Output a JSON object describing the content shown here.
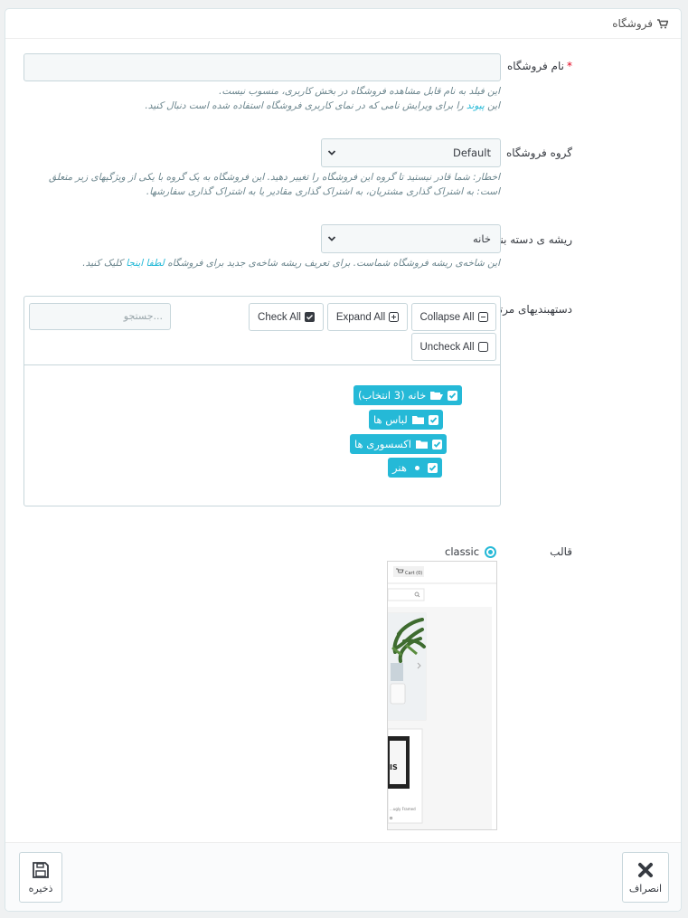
{
  "panel": {
    "title": "فروشگاه",
    "icon": "shopping-cart-icon"
  },
  "shop_name": {
    "label": "نام فروشگاه",
    "required_mark": "*",
    "value": "",
    "help_line1": "این فیلد به نام قابل مشاهده فروشگاه در بخش کاربری، منسوب نیست.",
    "help_line2_prefix": "این",
    "help_line2_link": "پیوند",
    "help_line2_suffix": "را برای ویرایش نامی که در نمای کاربری فروشگاه استفاده شده است دنبال کنید."
  },
  "shop_group": {
    "label": "گروه فروشگاه",
    "selected": "Default",
    "help": "اخطار: شما قادر نیستید تا گروه این فروشگاه را تغییر دهید. این فروشگاه به یک گروه با یکی از ویژگیهای زیر متعلق است: به اشتراک گذاری مشتریان، به اشتراک گذاری مقادیر یا به اشتراک گذاری سفارشها."
  },
  "category_root": {
    "label": "ریشه ی دسته بندی",
    "selected": "خانه",
    "help_prefix": "این شاخه‌ی ریشه فروشگاه شماست. برای تعریف ریشه شاخه‌ی جدید برای فروشگاه",
    "help_link": "لطفا اینجا",
    "help_suffix": "کلیک کنید."
  },
  "associated_categories": {
    "label": "دستهبندیهای مرتبط",
    "buttons": {
      "collapse_all": "Collapse All",
      "expand_all": "Expand All",
      "check_all": "Check All",
      "uncheck_all": "Uncheck All"
    },
    "search_placeholder": "...جستجو",
    "tree": [
      {
        "label": "خانه (3 انتخاب)",
        "icon": "folder-open-icon",
        "checked": true
      },
      {
        "label": "لباس ها",
        "icon": "folder-icon",
        "checked": true
      },
      {
        "label": "اکسسوری ها",
        "icon": "folder-icon",
        "checked": true
      },
      {
        "label": "هنر",
        "icon": "bullet-icon",
        "checked": true
      }
    ]
  },
  "theme": {
    "label": "قالب",
    "option": "classic",
    "selected": true,
    "preview": {
      "cart_label": "Cart (0)",
      "product_caption": "...ugly Framed",
      "price": "o"
    }
  },
  "footer": {
    "save_label": "ذخیره",
    "cancel_label": "انصراف"
  },
  "colors": {
    "accent": "#25b9d7",
    "required": "#e3001b",
    "help_text": "#6c868e"
  }
}
